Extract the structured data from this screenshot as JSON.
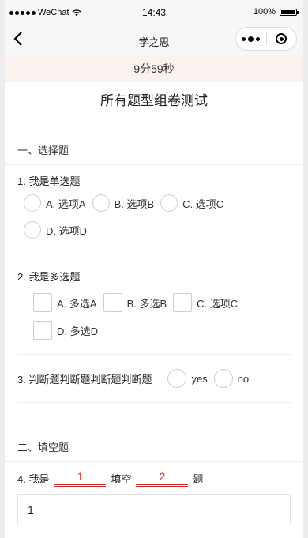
{
  "status_bar": {
    "carrier": "WeChat",
    "time": "14:43",
    "battery": "100%"
  },
  "nav": {
    "back_icon": "chevron-left-icon",
    "title": "学之思"
  },
  "timer": "9分59秒",
  "exam_title": "所有题型组卷测试",
  "section1": {
    "title": "一、选择题",
    "q1": {
      "text": "1. 我是单选题",
      "options": [
        "A. 选项A",
        "B. 选项B",
        "C. 选项C",
        "D. 选项D"
      ]
    },
    "q2": {
      "text": "2. 我是多选题",
      "options": [
        "A. 多选A",
        "B. 多选B",
        "C. 选项C",
        "D. 多选D"
      ]
    },
    "q3": {
      "text": "3. 判断题判断题判断题判断题",
      "options": [
        "yes",
        "no"
      ]
    }
  },
  "section2": {
    "title": "二、填空题",
    "q4": {
      "prefix": "4. 我是",
      "blank1": "1",
      "middle": "填空",
      "blank2": "2",
      "suffix": "题",
      "answer": "1"
    }
  },
  "colors": {
    "timer_bg": "#fbf1ee",
    "blank_accent": "#d43030"
  }
}
